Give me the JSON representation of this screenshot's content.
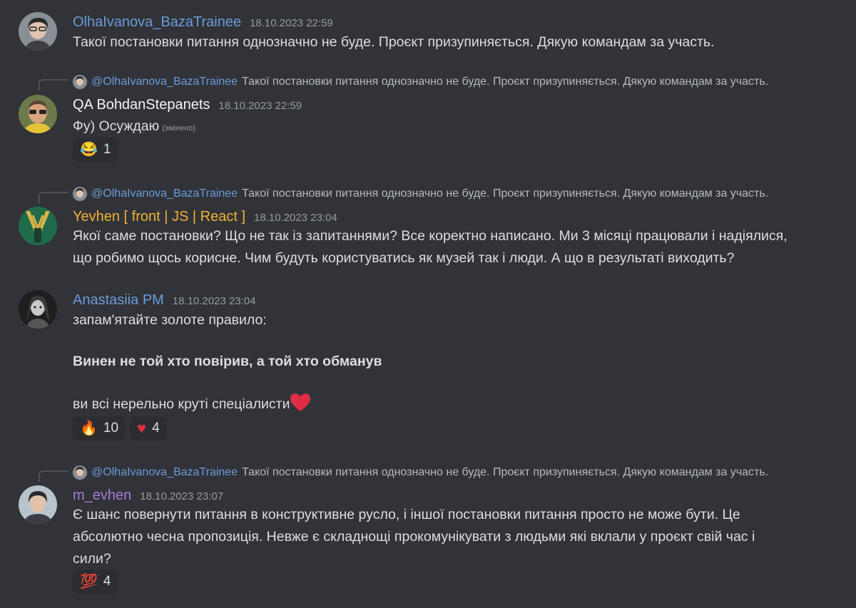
{
  "colors": {
    "background": "#313338",
    "olha": "#6b9bd8",
    "bohdan": "#f2f3f5",
    "yevhen": "#f0b232",
    "anastasiia": "#6b9bd8",
    "mevhen": "#a67bd6",
    "reply_user": "#6b9bd8"
  },
  "messages": [
    {
      "author": "OlhaIvanova_BazaTrainee",
      "timestamp": "18.10.2023 22:59",
      "text": "Такої постановки питання однозначно не буде. Проєкт призупиняється. Дякую командам за участь."
    },
    {
      "reply": {
        "user": "@OlhaIvanova_BazaTrainee",
        "text": "Такої постановки питання однозначно не буде. Проєкт призупиняється. Дякую командам за участь."
      },
      "author": "QA BohdanStepanets",
      "timestamp": "18.10.2023 22:59",
      "text": "Фу) Осуждаю",
      "edited": "(змінено)",
      "reactions": [
        {
          "emoji": "😂",
          "count": "1"
        }
      ]
    },
    {
      "reply": {
        "user": "@OlhaIvanova_BazaTrainee",
        "text": "Такої постановки питання однозначно не буде. Проєкт призупиняється. Дякую командам за участь."
      },
      "author": "Yevhen [ front | JS | React ]",
      "timestamp": "18.10.2023 23:04",
      "text_line1": "Якої саме постановки? Що не так із запитаннями? Все коректно написано. Ми 3 місяці працювали і надіялися,",
      "text_line2": "що робимо щось корисне. Чим будуть користуватись як музей так і люди. А що в результаті виходить?"
    },
    {
      "author": "Anastasiia PM",
      "timestamp": "18.10.2023 23:04",
      "text_line1": "запам'ятайте золоте правило:",
      "text_bold": "Винен не той хто повірив, а той хто обманув",
      "text_line3": "ви всі нерельно круті спеціалисти",
      "reactions": [
        {
          "emoji": "🔥",
          "count": "10"
        },
        {
          "emoji": "♥",
          "count": "4"
        }
      ]
    },
    {
      "reply": {
        "user": "@OlhaIvanova_BazaTrainee",
        "text": "Такої постановки питання однозначно не буде. Проєкт призупиняється. Дякую командам за участь."
      },
      "author": "m_evhen",
      "timestamp": "18.10.2023 23:07",
      "text_line1": "Є шанс повернути питання в конструктивне русло, і іншої постановки питання просто не може бути. Це",
      "text_line2": "абсолютно чесна пропозиція. Невже є складнощі прокомунікувати з людьми які вклали у проєкт свій час і",
      "text_line3": "сили?",
      "reactions": [
        {
          "emoji": "💯",
          "count": "4"
        }
      ]
    }
  ]
}
